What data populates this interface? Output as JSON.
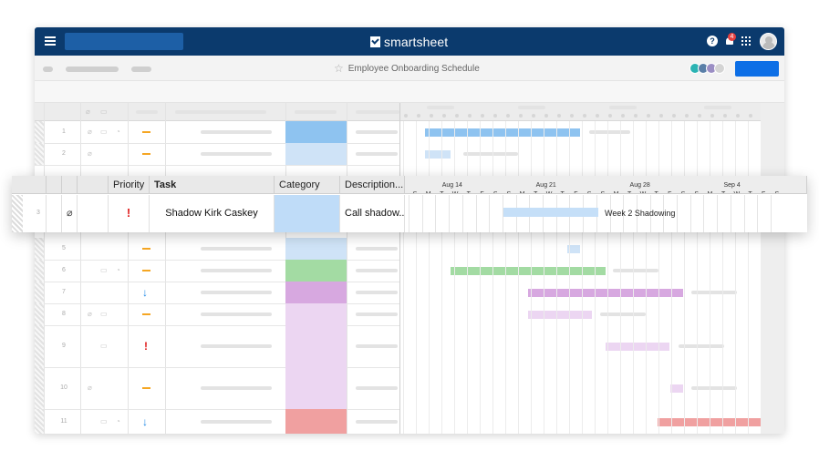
{
  "topbar": {
    "brand": "smartsheet",
    "notification_count": "4"
  },
  "sheet": {
    "title": "Employee Onboarding Schedule"
  },
  "columns": {
    "priority": "Priority",
    "task": "Task",
    "category": "Category",
    "description": "Description..."
  },
  "timeline": {
    "weeks": [
      "Aug 14",
      "Aug 21",
      "Aug 28",
      "Sep 4"
    ],
    "days": [
      "S",
      "M",
      "T",
      "W",
      "T",
      "F",
      "S",
      "S",
      "M",
      "T",
      "W",
      "T",
      "F",
      "S",
      "S",
      "M",
      "T",
      "W",
      "T",
      "F",
      "S",
      "S",
      "M",
      "T",
      "W",
      "T",
      "F",
      "S"
    ]
  },
  "focused_row": {
    "row_number": "3",
    "priority": "!",
    "task": "Shadow Kirk Caskey",
    "description": "Call shadow...",
    "bar_label": "Week 2 Shadowing"
  },
  "rows": [
    {
      "num": "1",
      "priority": "—"
    },
    {
      "num": "2",
      "priority": "—"
    },
    {
      "num": "5",
      "priority": "—"
    },
    {
      "num": "6",
      "priority": "—"
    },
    {
      "num": "7",
      "priority": "↓"
    },
    {
      "num": "8",
      "priority": "—"
    },
    {
      "num": "9",
      "priority": "!"
    },
    {
      "num": "10",
      "priority": "—"
    },
    {
      "num": "11",
      "priority": "↓"
    }
  ],
  "colors": {
    "topbar": "#0b3a6d",
    "share_button": "#0d6fe6",
    "category_blue": "#8ec3f0",
    "category_light_blue": "#cfe3f7",
    "category_green": "#a3dba3",
    "category_purple": "#d7a8e0",
    "category_light_purple": "#ecd6f2",
    "category_red": "#f0a0a0"
  }
}
